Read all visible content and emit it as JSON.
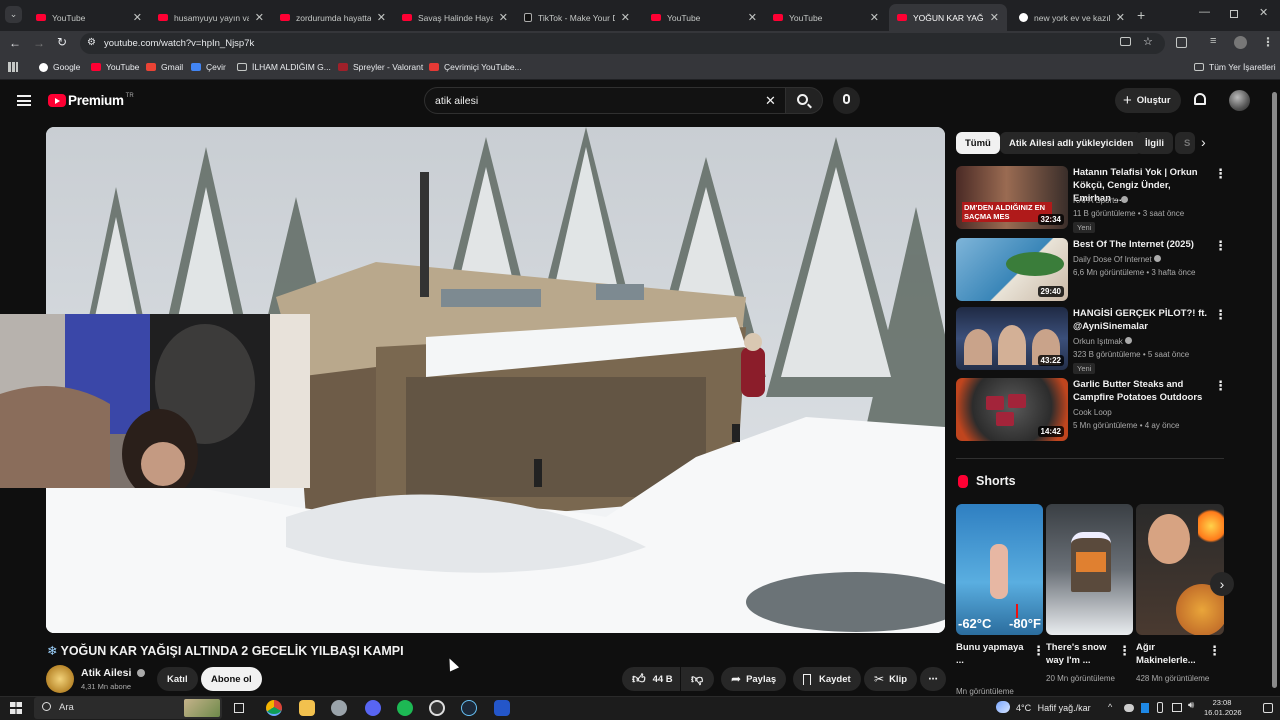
{
  "browser": {
    "tabs": [
      {
        "title": "YouTube",
        "active": false,
        "icon": "youtube-favicon"
      },
      {
        "title": "husamyuyu yayın vakit",
        "active": false,
        "icon": "youtube-favicon"
      },
      {
        "title": "zordurumda hayatta",
        "active": false,
        "icon": "youtube-favicon"
      },
      {
        "title": "Savaş Halinde Hayatt",
        "active": false,
        "icon": "youtube-favicon"
      },
      {
        "title": "TikTok - Make Your D",
        "active": false,
        "icon": "tiktok-favicon"
      },
      {
        "title": "YouTube",
        "active": false,
        "icon": "youtube-favicon"
      },
      {
        "title": "YouTube",
        "active": false,
        "icon": "youtube-favicon"
      },
      {
        "title": "YOĞUN KAR YAĞIŞ",
        "active": true,
        "icon": "youtube-favicon"
      },
      {
        "title": "new york ev ve kazık",
        "active": false,
        "icon": "google-favicon"
      }
    ],
    "url": "youtube.com/watch?v=hpIn_Njsp7k",
    "bookmarks": [
      "Google",
      "YouTube",
      "Gmail",
      "Çevir",
      "İLHAM ALDIĞIM G...",
      "Spreyler - Valorant",
      "Çevrimiçi YouTube..."
    ],
    "all_bookmarks": "Tüm Yer İşaretleri"
  },
  "yt": {
    "logo": "Premium",
    "logo_region": "TR",
    "search_value": "atik ailesi",
    "create_label": "Oluştur",
    "chips": [
      "Tümü",
      "Atik Ailesi adlı yükleyiciden",
      "İlgili",
      "S"
    ],
    "video": {
      "title_icon": "❄",
      "title": "YOĞUN KAR YAĞIŞI ALTINDA 2 GECELİK YILBAŞI KAMPI",
      "channel": "Atik Ailesi",
      "subs": "4,31 Mn abone",
      "join": "Katıl",
      "subscribe": "Abone ol",
      "likes": "44 B",
      "share": "Paylaş",
      "save": "Kaydet",
      "clip": "Klip"
    },
    "recs": [
      {
        "title": "Hatanın Telafisi Yok | Orkun Kökçü, Cengiz Ünder, Emirhan ...",
        "channel": "KAFA Sports",
        "verified": true,
        "meta": "11 B görüntüleme • 3 saat önce",
        "badge": "Yeni",
        "duration": "32:34",
        "thumb_text": "DM'DEN ALDIĞINIZ EN SAÇMA MES"
      },
      {
        "title": "Best Of The Internet (2025)",
        "channel": "Daily Dose Of Internet",
        "verified": true,
        "meta": "6,6 Mn görüntüleme • 3 hafta önce",
        "badge": "",
        "duration": "29:40",
        "thumb_text": ""
      },
      {
        "title": "HANGİSİ GERÇEK PİLOT?! ft. @AyniSinemalar",
        "channel": "Orkun Işıtmak",
        "verified": true,
        "meta": "323 B görüntüleme • 5 saat önce",
        "badge": "Yeni",
        "duration": "43:22",
        "thumb_text": ""
      },
      {
        "title": "Garlic Butter Steaks and Campfire Potatoes Outdoors",
        "channel": "Cook Loop",
        "verified": false,
        "meta": "5 Mn görüntüleme • 4 ay önce",
        "badge": "",
        "duration": "14:42",
        "thumb_text": ""
      }
    ],
    "shorts_label": "Shorts",
    "shorts": [
      {
        "title": "Bunu yapmaya ...",
        "meta": "Mn görüntüleme",
        "thumb_text_a": "-62°C",
        "thumb_text_b": "-80°F"
      },
      {
        "title": "There's snow way I'm ...",
        "meta": "20 Mn görüntüleme",
        "thumb_text_a": "",
        "thumb_text_b": ""
      },
      {
        "title": "Ağır Makinelerle...",
        "meta": "428 Mn görüntüleme",
        "thumb_text_a": "",
        "thumb_text_b": ""
      }
    ]
  },
  "taskbar": {
    "search": "Ara",
    "temp": "4°C",
    "weather": "Hafif yağ./kar",
    "time": "23:08",
    "date": "16.01.2026"
  }
}
